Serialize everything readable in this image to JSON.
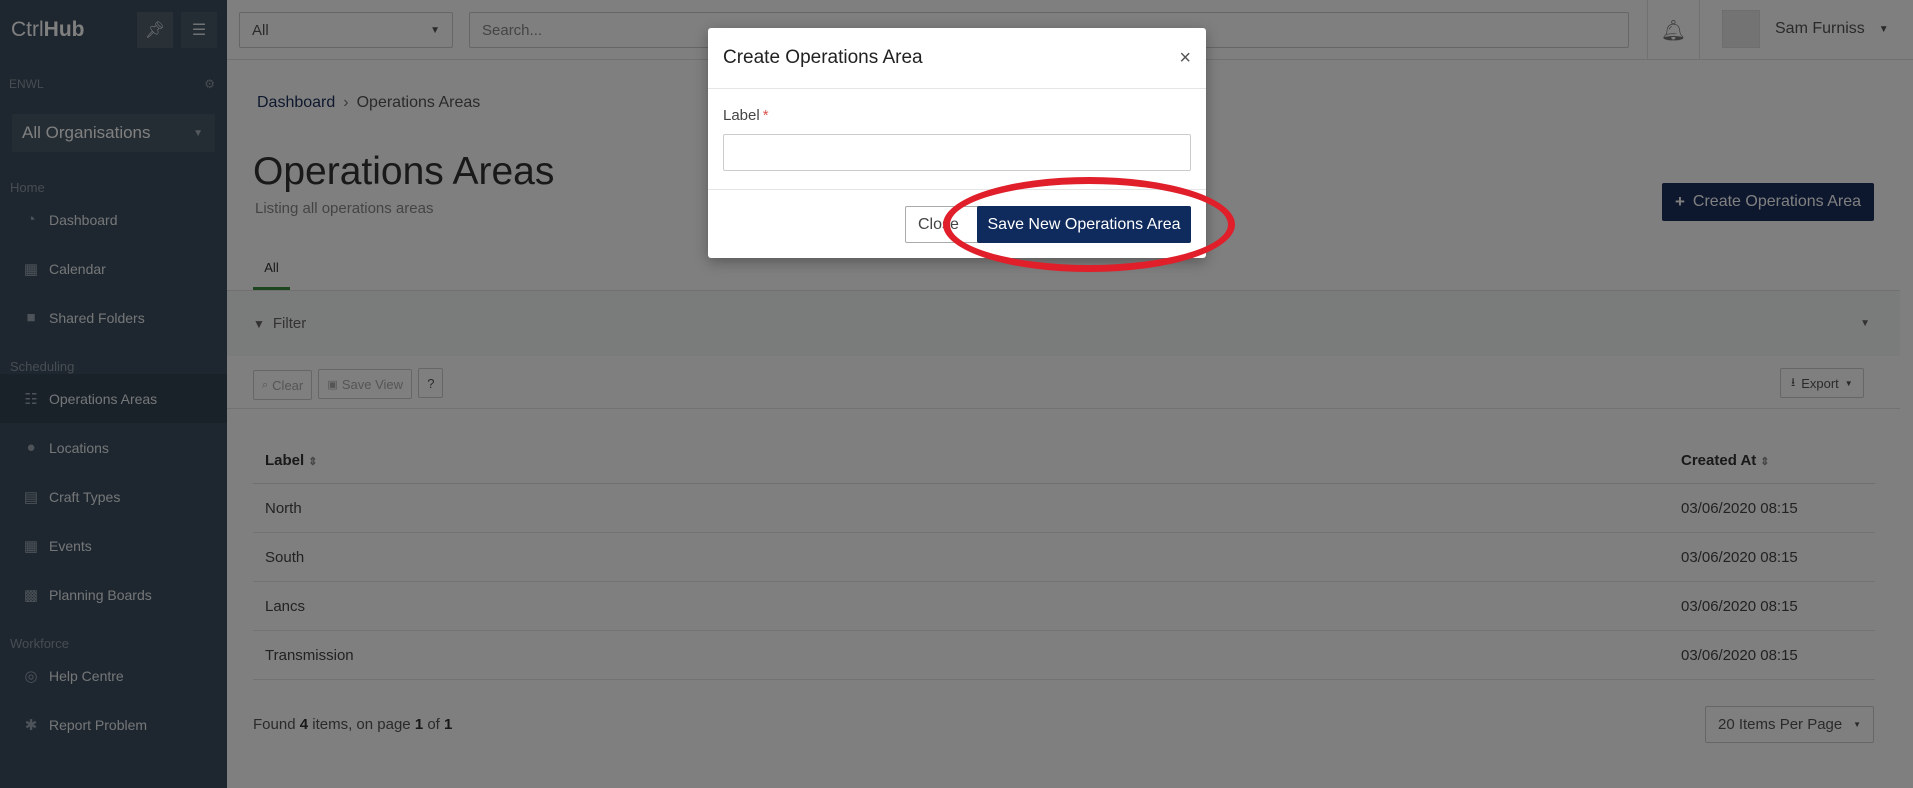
{
  "brand": {
    "prefix": "Ctrl",
    "suffix": "Hub"
  },
  "sidebar": {
    "org_code": "ENWL",
    "org_select": "All Organisations",
    "sections": [
      {
        "title": "Home",
        "items": [
          {
            "label": "Dashboard",
            "icon": "dashboard-icon"
          },
          {
            "label": "Calendar",
            "icon": "calendar-icon"
          },
          {
            "label": "Shared Folders",
            "icon": "folder-icon"
          }
        ]
      },
      {
        "title": "Scheduling",
        "items": [
          {
            "label": "Operations Areas",
            "icon": "list-icon",
            "active": true
          },
          {
            "label": "Locations",
            "icon": "pin-icon"
          },
          {
            "label": "Craft Types",
            "icon": "table-icon"
          },
          {
            "label": "Events",
            "icon": "calendar-icon"
          },
          {
            "label": "Planning Boards",
            "icon": "grid-icon"
          }
        ]
      },
      {
        "title": "Workforce",
        "items": [
          {
            "label": "Help Centre",
            "icon": "lifebuoy-icon"
          },
          {
            "label": "Report Problem",
            "icon": "bug-icon"
          }
        ]
      }
    ]
  },
  "topbar": {
    "scope_select": "All",
    "search_placeholder": "Search...",
    "user_name": "Sam Furniss"
  },
  "main": {
    "breadcrumb": [
      "Dashboard",
      "Operations Areas"
    ],
    "title": "Operations Areas",
    "subtitle": "Listing all operations areas",
    "create_button": "Create Operations Area",
    "tabs": [
      "All"
    ],
    "filter_label": "Filter",
    "toolbar": {
      "clear": "Clear",
      "save_view": "Save View",
      "help": "?",
      "export": "Export"
    },
    "table": {
      "columns": [
        "Label",
        "Created At"
      ],
      "rows": [
        {
          "label": "North",
          "created_at": "03/06/2020 08:15"
        },
        {
          "label": "South",
          "created_at": "03/06/2020 08:15"
        },
        {
          "label": "Lancs",
          "created_at": "03/06/2020 08:15"
        },
        {
          "label": "Transmission",
          "created_at": "03/06/2020 08:15"
        }
      ]
    },
    "pagination": {
      "prefix": "Found",
      "count": "4",
      "mid": "items, on page",
      "page": "1",
      "of": "of",
      "total_pages": "1",
      "per_page": "20 Items Per Page"
    }
  },
  "modal": {
    "title": "Create Operations Area",
    "field_label": "Label",
    "required_mark": "*",
    "field_value": "",
    "close_button": "Close",
    "save_button": "Save New Operations Area"
  },
  "colors": {
    "primary": "#1a2f5c",
    "sidebar": "#3d4e5e",
    "highlight_ring": "#e01f2a",
    "tab_active": "#3b8a3e"
  }
}
